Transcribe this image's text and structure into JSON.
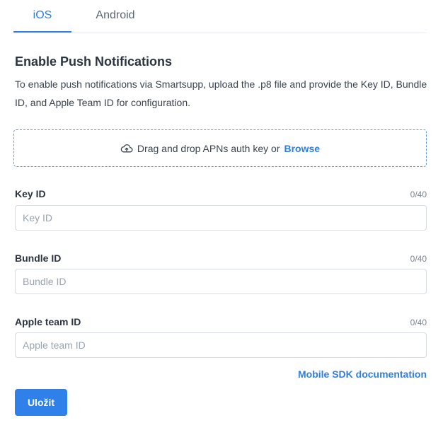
{
  "tabs": [
    {
      "label": "iOS",
      "active": true
    },
    {
      "label": "Android",
      "active": false
    }
  ],
  "section": {
    "title": "Enable Push Notifications",
    "description": "To enable push notifications via Smartsupp, upload the .p8 file and provide the Key ID, Bundle ID, and Apple Team ID for configuration."
  },
  "dropzone": {
    "icon": "cloud-upload-icon",
    "text": "Drag and drop APNs auth key or",
    "browse_label": "Browse"
  },
  "fields": [
    {
      "label": "Key ID",
      "counter": "0/40",
      "value": "",
      "placeholder": "Key ID"
    },
    {
      "label": "Bundle ID",
      "counter": "0/40",
      "value": "",
      "placeholder": "Bundle ID"
    },
    {
      "label": "Apple team ID",
      "counter": "0/40",
      "value": "",
      "placeholder": "Apple team ID"
    }
  ],
  "links": {
    "documentation": "Mobile SDK documentation"
  },
  "actions": {
    "save_label": "Uložit"
  },
  "colors": {
    "accent": "#2f7fe0",
    "button": "#2f80e8",
    "dropzone_border": "#5b98dd"
  }
}
